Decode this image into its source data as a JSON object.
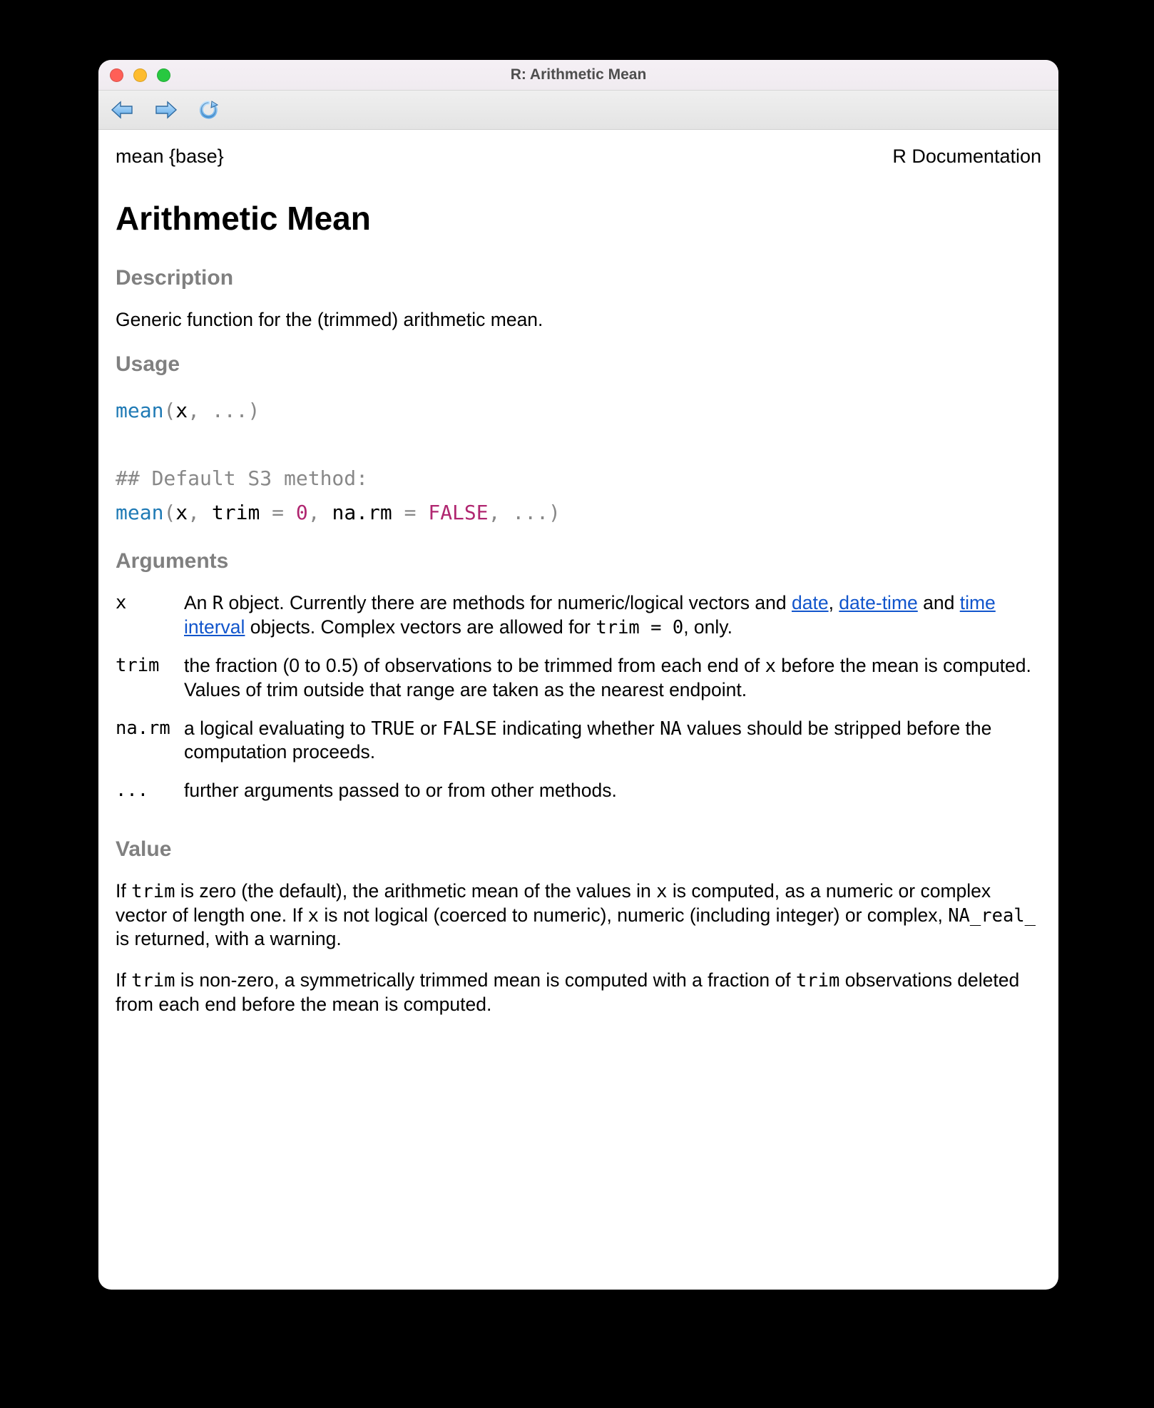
{
  "window": {
    "title": "R: Arithmetic Mean"
  },
  "header": {
    "left": "mean {base}",
    "right": "R Documentation"
  },
  "page_title": "Arithmetic Mean",
  "sections": {
    "description_h": "Description",
    "description_p": "Generic function for the (trimmed) arithmetic mean.",
    "usage_h": "Usage",
    "arguments_h": "Arguments",
    "value_h": "Value"
  },
  "usage": {
    "line1": {
      "fn": "mean",
      "open": "(",
      "sig": "x",
      "sep1": ", ",
      "dots": "...",
      "close": ")"
    },
    "comment": "## Default S3 method:",
    "line2": {
      "fn": "mean",
      "open": "(",
      "a1": "x",
      "s1": ", ",
      "a2": "trim",
      "eq1": " = ",
      "v1": "0",
      "s2": ", ",
      "a3": "na.rm",
      "eq2": " = ",
      "v2": "FALSE",
      "s3": ", ",
      "dots": "...",
      "close": ")"
    }
  },
  "args": {
    "x": {
      "name": "x",
      "t1": "An ",
      "c1": "R",
      "t2": " object. Currently there are methods for numeric/logical vectors and ",
      "l1": "date",
      "t3": ", ",
      "l2": "date-time",
      "t4": " and ",
      "l3": "time interval",
      "t5": " objects. Complex vectors are allowed for ",
      "c2": "trim = 0",
      "t6": ", only."
    },
    "trim": {
      "name": "trim",
      "t1": "the fraction (0 to 0.5) of observations to be trimmed from each end of ",
      "c1": "x",
      "t2": " before the mean is computed. Values of trim outside that range are taken as the nearest endpoint."
    },
    "narm": {
      "name": "na.rm",
      "t1": "a logical evaluating to ",
      "c1": "TRUE",
      "t2": " or ",
      "c2": "FALSE",
      "t3": " indicating whether ",
      "c3": "NA",
      "t4": " values should be stripped before the computation proceeds."
    },
    "dots": {
      "name": "...",
      "t1": "further arguments passed to or from other methods."
    }
  },
  "value": {
    "p1": {
      "t1": "If ",
      "c1": "trim",
      "t2": " is zero (the default), the arithmetic mean of the values in ",
      "c2": "x",
      "t3": " is computed, as a numeric or complex vector of length one. If ",
      "c3": "x",
      "t4": " is not logical (coerced to numeric), numeric (including integer) or complex, ",
      "c4": "NA_real_",
      "t5": " is returned, with a warning."
    },
    "p2": {
      "t1": "If ",
      "c1": "trim",
      "t2": " is non-zero, a symmetrically trimmed mean is computed with a fraction of ",
      "c2": "trim",
      "t3": " observations deleted from each end before the mean is computed."
    }
  }
}
